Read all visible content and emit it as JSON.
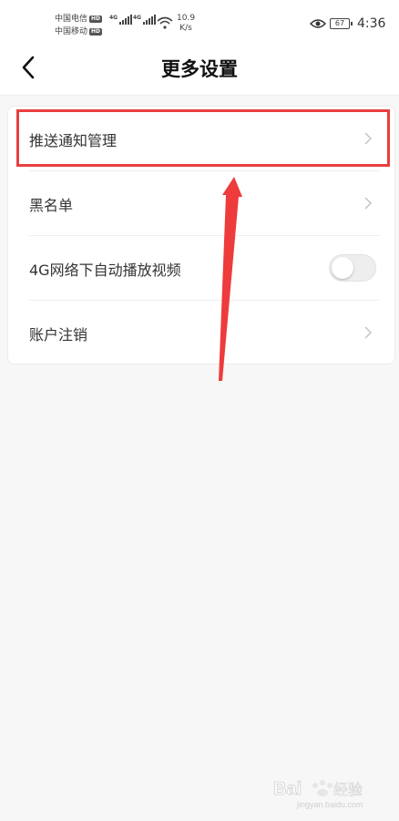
{
  "status_bar": {
    "carrier1": "中国电信",
    "carrier2": "中国移动",
    "hd_badge": "HD",
    "network_type": "4G",
    "speed_value": "10.9",
    "speed_unit": "K/s",
    "battery_level": "67",
    "time": "4:36"
  },
  "nav": {
    "title": "更多设置",
    "back_icon": "back-arrow-icon"
  },
  "settings": {
    "items": [
      {
        "label": "推送通知管理",
        "control": "chevron"
      },
      {
        "label": "黑名单",
        "control": "chevron"
      },
      {
        "label": "4G网络下自动播放视频",
        "control": "toggle",
        "toggle_on": false
      },
      {
        "label": "账户注销",
        "control": "chevron"
      }
    ]
  },
  "annotation": {
    "highlight_color": "#e8403f",
    "arrow_color": "#ee3b3b"
  },
  "watermark": {
    "brand": "Bai",
    "brand_cn": "经验",
    "url": "jingyan.baidu.com"
  }
}
